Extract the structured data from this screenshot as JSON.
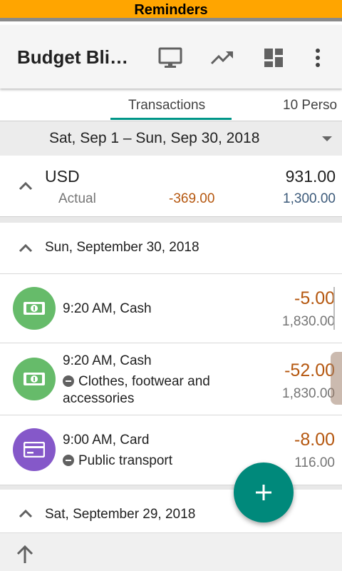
{
  "banner": {
    "title": "Reminders"
  },
  "appbar": {
    "title": "Budget Bli…",
    "icons": [
      "monitor-icon",
      "trending-up-icon",
      "dashboard-icon",
      "more-vert-icon"
    ]
  },
  "tabs": [
    {
      "label": "Transactions",
      "selected": true
    },
    {
      "label": "10 Perso",
      "selected": false
    }
  ],
  "date_range": {
    "label": "Sat, Sep 1 – Sun, Sep 30, 2018"
  },
  "summary": {
    "currency": "USD",
    "total": "931.00",
    "actual_label": "Actual",
    "actual_value": "-369.00",
    "budget_value": "1,300.00"
  },
  "days": [
    {
      "label": "Sun, September 30, 2018",
      "transactions": [
        {
          "time_account": "9:20 AM, Cash",
          "category": "",
          "amount": "-5.00",
          "balance": "1,830.00",
          "icon": "cash-icon",
          "color": "#66bb6a"
        },
        {
          "time_account": "9:20 AM, Cash",
          "category": "Clothes, footwear and accessories",
          "amount": "-52.00",
          "balance": "1,830.00",
          "icon": "cash-icon",
          "color": "#66bb6a"
        },
        {
          "time_account": "9:00 AM, Card",
          "category": "Public transport",
          "amount": "-8.00",
          "balance": "116.00",
          "icon": "card-icon",
          "color": "#8558c9"
        }
      ]
    },
    {
      "label": "Sat, September 29, 2018",
      "transactions": []
    }
  ],
  "fab": {
    "icon": "add-icon"
  },
  "bottom": {
    "icon": "arrow-up-icon"
  },
  "colors": {
    "banner": "#ffa500",
    "accent": "#009688",
    "negative": "#b5570f",
    "budget": "#3c5a7a"
  }
}
